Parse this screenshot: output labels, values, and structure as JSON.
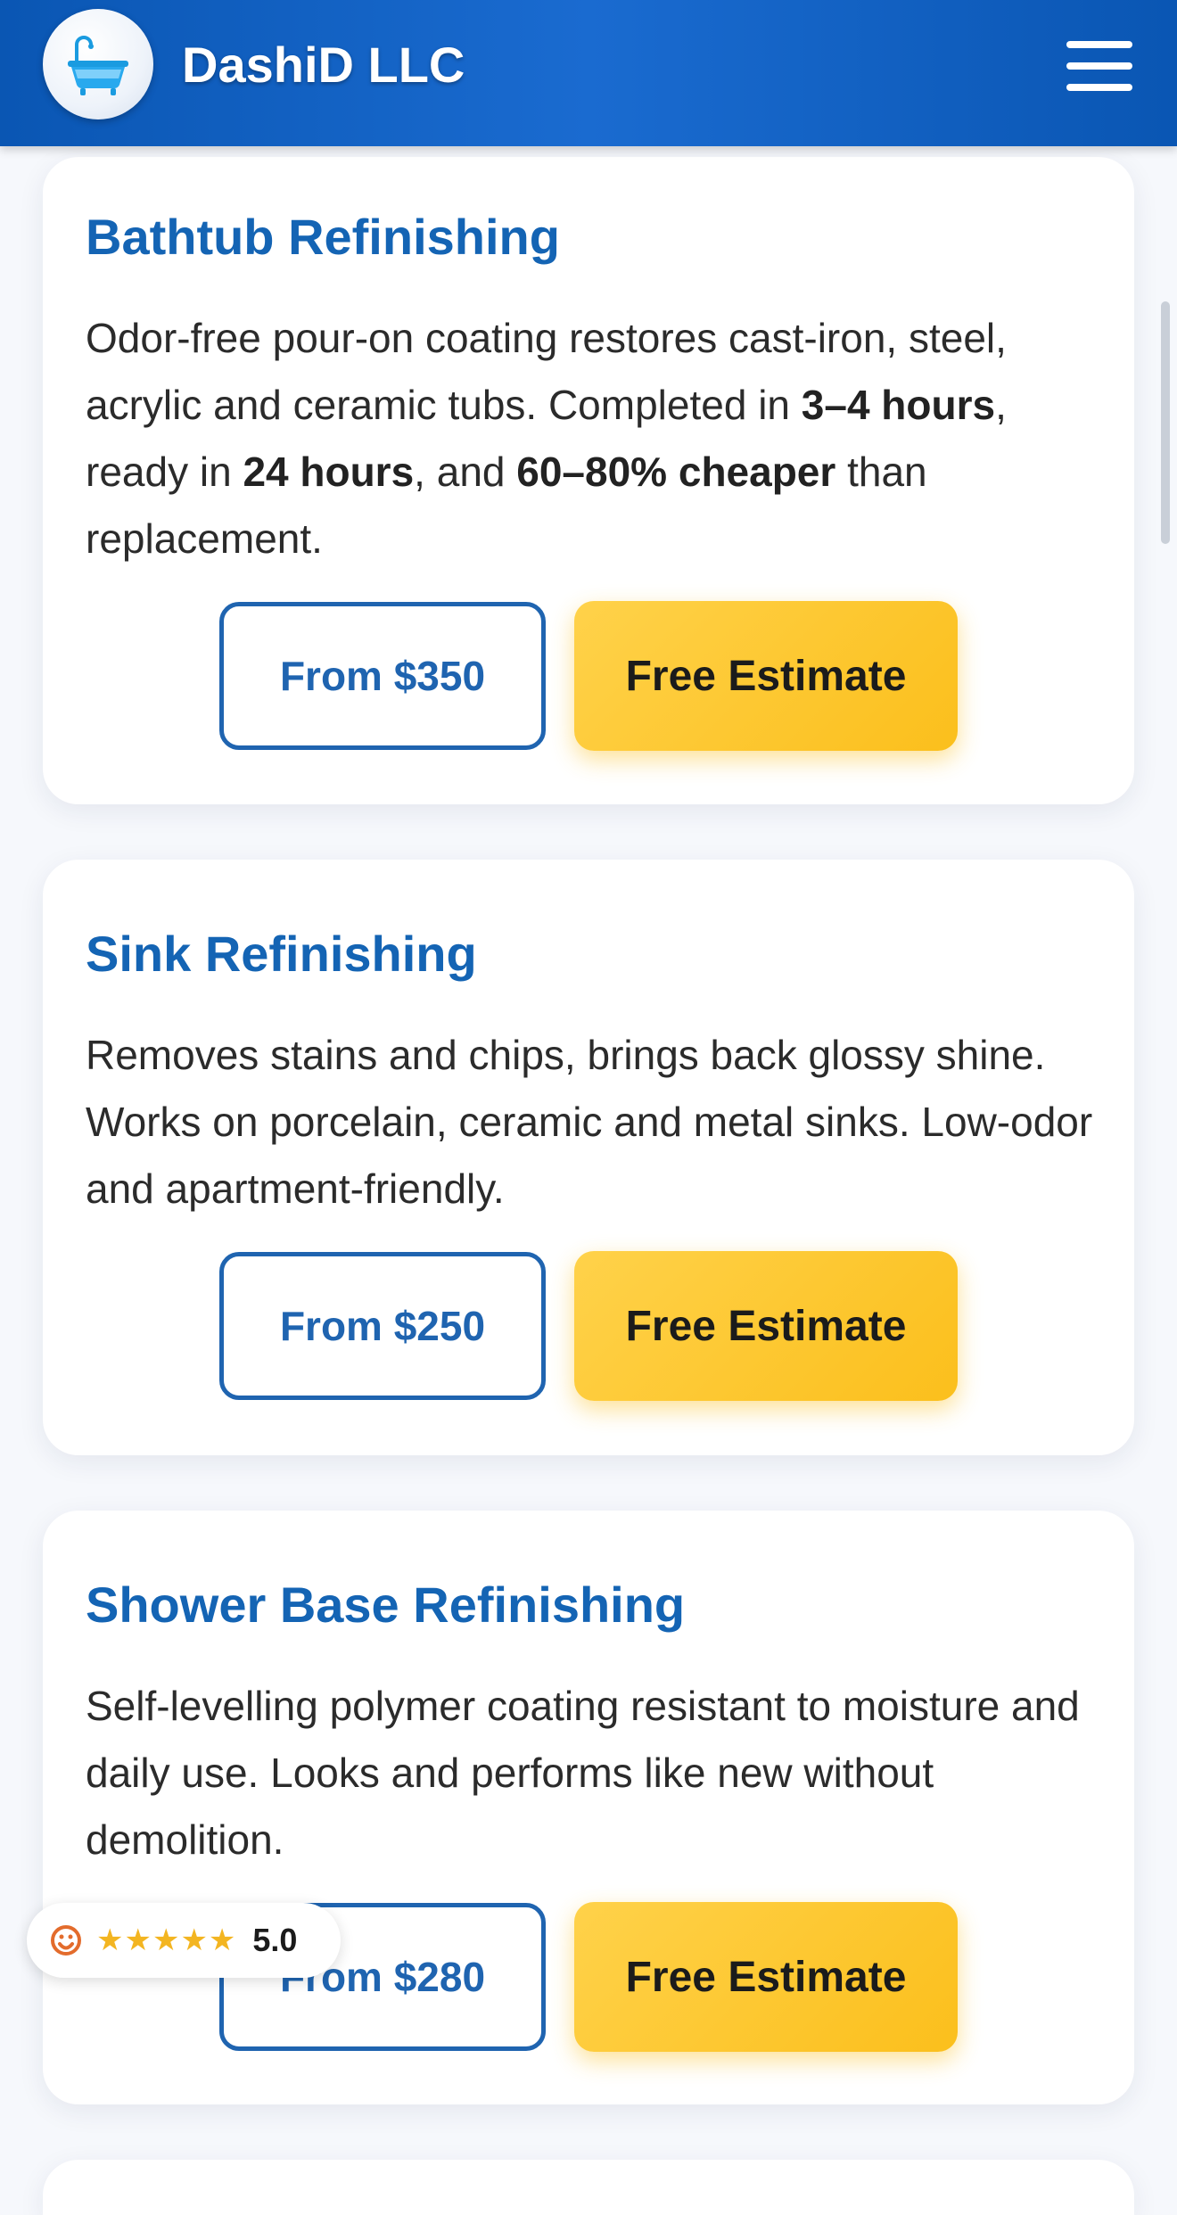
{
  "header": {
    "brand": "DashiD LLC",
    "logo_icon": "bathtub-icon",
    "menu_icon": "hamburger-menu-icon"
  },
  "colors": {
    "header_blue": "#0a56b3",
    "title_blue": "#1464b4",
    "button_outline": "#1f64b0",
    "cta_yellow": "#fbbf1c",
    "star_yellow": "#f3b521"
  },
  "services": [
    {
      "title": "Bathtub Refinishing",
      "desc": {
        "t1": "Odor-free pour-on coating restores cast-iron, steel, acrylic and ceramic tubs. Completed in ",
        "b1": "3–4 hours",
        "t2": ", ready in ",
        "b2": "24 hours",
        "t3": ", and ",
        "b3": "60–80% cheaper",
        "t4": " than replacement."
      },
      "price": "From $350",
      "cta": "Free Estimate"
    },
    {
      "title": "Sink Refinishing",
      "description": "Removes stains and chips, brings back glossy shine. Works on porcelain, ceramic and metal sinks. Low-odor and apartment-friendly.",
      "price": "From $250",
      "cta": "Free Estimate"
    },
    {
      "title": "Shower Base Refinishing",
      "description": "Self-levelling polymer coating resistant to moisture and daily use. Looks and performs like new without demolition.",
      "price": "From $280",
      "cta": "Free Estimate"
    }
  ],
  "rating_badge": {
    "stars": "★★★★★",
    "score": "5.0",
    "source_icon": "review-source-icon"
  }
}
